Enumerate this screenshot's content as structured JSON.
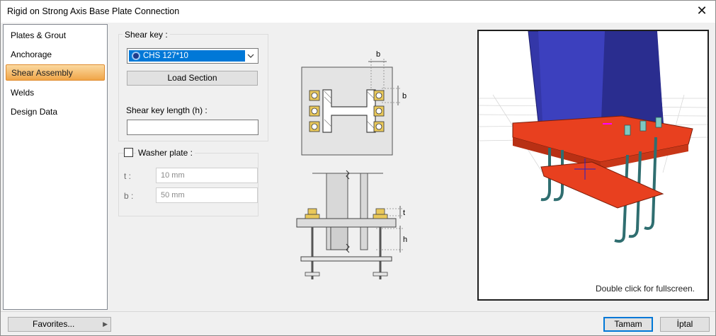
{
  "window": {
    "title": "Rigid on Strong Axis Base Plate Connection",
    "close_glyph": "✕"
  },
  "sidebar": {
    "items": [
      {
        "label": "Plates & Grout"
      },
      {
        "label": "Anchorage"
      },
      {
        "label": "Shear Assembly",
        "active": true
      },
      {
        "label": "Welds"
      },
      {
        "label": "Design Data"
      }
    ]
  },
  "shear_key": {
    "group_label": "Shear key :",
    "section_value": "CHS 127*10",
    "load_section_label": "Load Section",
    "length_label": "Shear key length (h) :",
    "length_value": ""
  },
  "washer_plate": {
    "label": "Washer plate :",
    "checked": false,
    "t_label": "t :",
    "t_value": "10 mm",
    "b_label": "b :",
    "b_value": "50 mm"
  },
  "diagram": {
    "labels": {
      "b_top": "b",
      "b_side": "b",
      "t": "t",
      "h": "h"
    }
  },
  "preview": {
    "hint": "Double click for fullscreen."
  },
  "footer": {
    "favorites_label": "Favorites...",
    "favorites_arrow": "▶",
    "ok_label": "Tamam",
    "cancel_label": "İptal"
  },
  "colors": {
    "accent": "#0078d7",
    "column": "#3b3fb7",
    "plate": "#e8401f",
    "active_item": "#f0a548"
  }
}
